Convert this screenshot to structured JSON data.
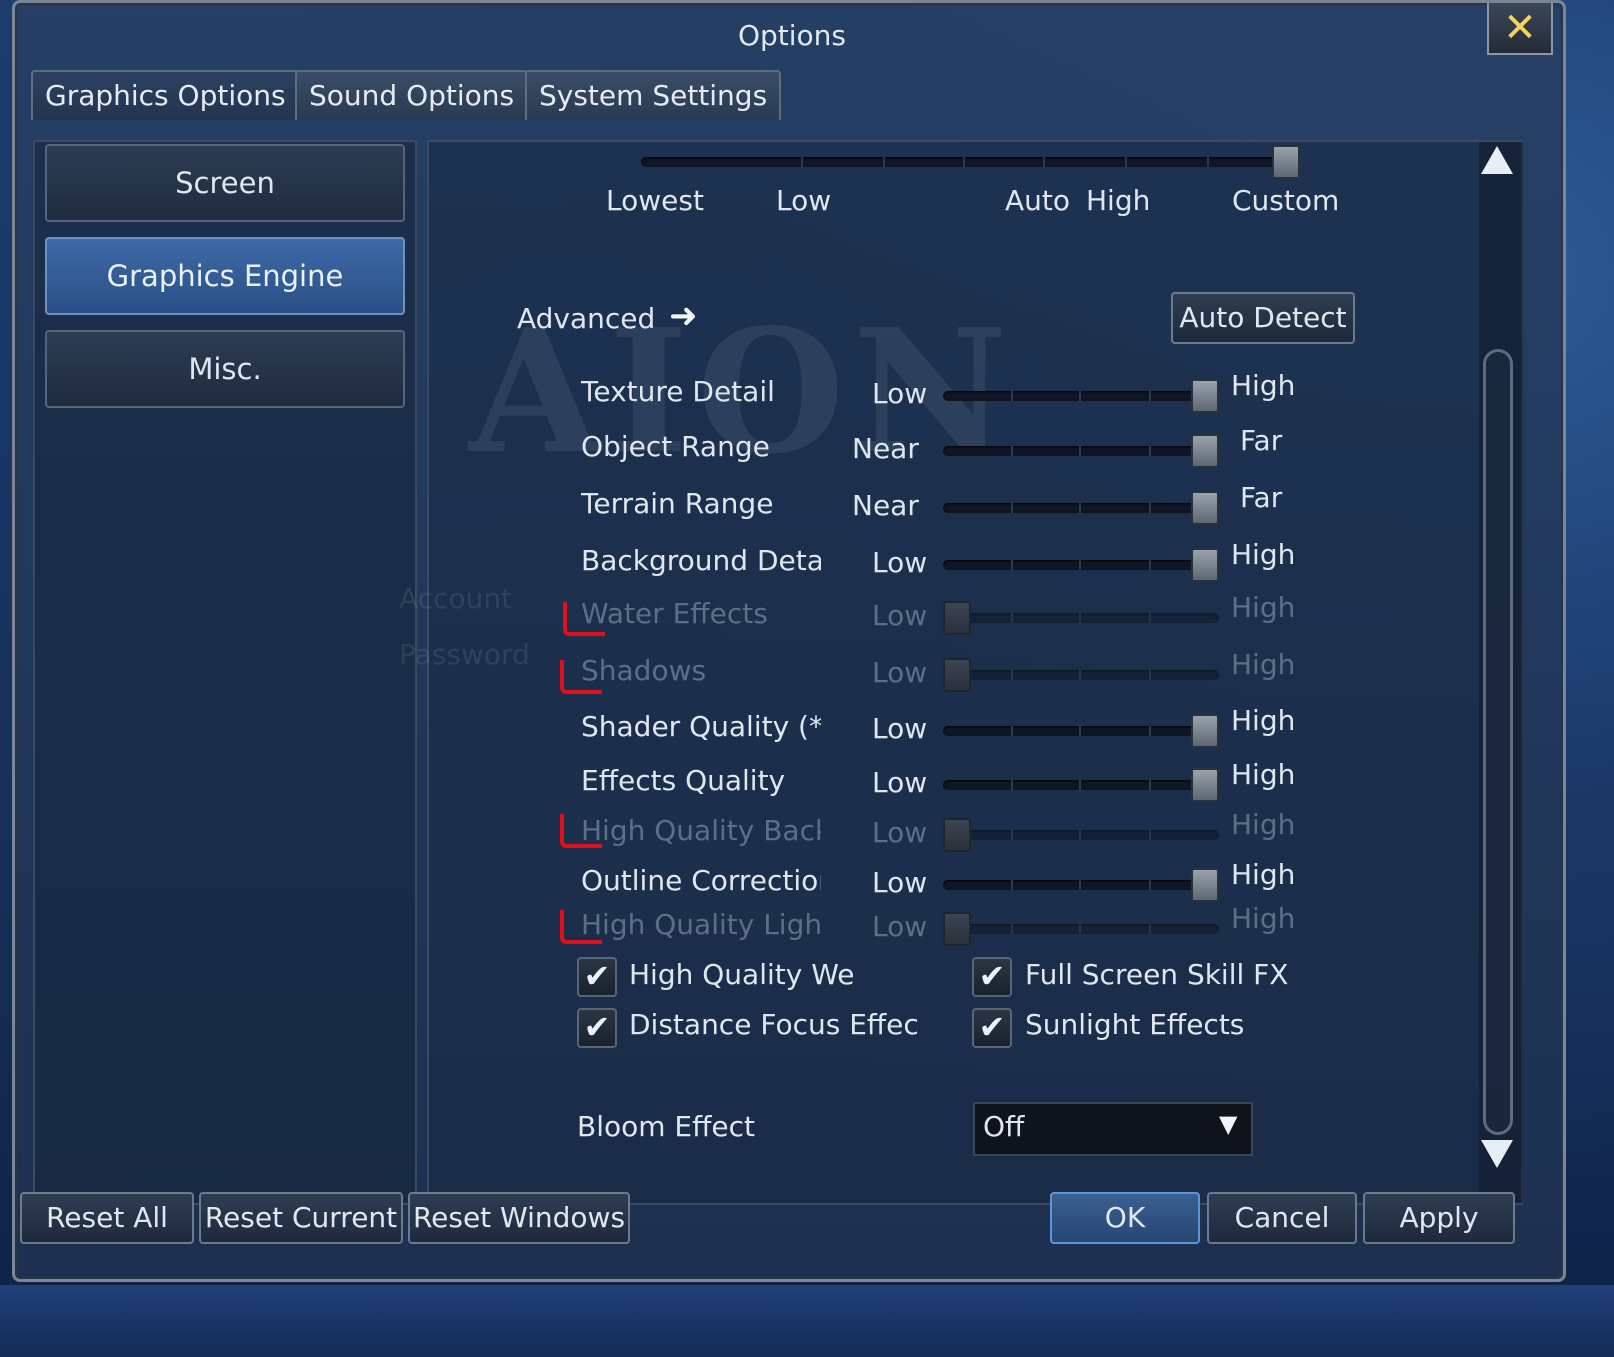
{
  "window": {
    "title": "Options",
    "close_symbol": "✕"
  },
  "tabs": [
    {
      "label": "Graphics Options",
      "active": true
    },
    {
      "label": "Sound Options",
      "active": false
    },
    {
      "label": "System Settings",
      "active": false
    }
  ],
  "sidebar": {
    "items": [
      {
        "label": "Screen",
        "selected": false
      },
      {
        "label": "Graphics Engine",
        "selected": true
      },
      {
        "label": "Misc.",
        "selected": false
      }
    ]
  },
  "preset": {
    "labels": [
      "Lowest",
      "Low",
      "Auto",
      "High",
      "Custom"
    ],
    "selected": "Custom"
  },
  "advanced": {
    "label": "Advanced",
    "arrow": "➜",
    "auto_detect": "Auto Detect"
  },
  "background_text": {
    "watermark": "AION",
    "account": "Account",
    "password": "Password"
  },
  "settings": [
    {
      "label": "Texture Detail",
      "min": "Low",
      "max": "High",
      "value": 1,
      "enabled": true
    },
    {
      "label": "Object Range",
      "min": "Near",
      "max": "Far",
      "value": 1,
      "enabled": true
    },
    {
      "label": "Terrain Range",
      "min": "Near",
      "max": "Far",
      "value": 1,
      "enabled": true
    },
    {
      "label": "Background Deta",
      "min": "Low",
      "max": "High",
      "value": 1,
      "enabled": true
    },
    {
      "label": "Water Effects",
      "min": "Low",
      "max": "High",
      "value": 0,
      "enabled": false
    },
    {
      "label": "Shadows",
      "min": "Low",
      "max": "High",
      "value": 0,
      "enabled": false
    },
    {
      "label": "Shader Quality (*",
      "min": "Low",
      "max": "High",
      "value": 1,
      "enabled": true
    },
    {
      "label": "Effects Quality",
      "min": "Low",
      "max": "High",
      "value": 1,
      "enabled": true
    },
    {
      "label": "High Quality Back",
      "min": "Low",
      "max": "High",
      "value": 0,
      "enabled": false
    },
    {
      "label": "Outline Correctior",
      "min": "Low",
      "max": "High",
      "value": 1,
      "enabled": true
    },
    {
      "label": "High Quality Ligh",
      "min": "Low",
      "max": "High",
      "value": 0,
      "enabled": false
    }
  ],
  "checkboxes": [
    {
      "label": "High Quality We",
      "checked": true
    },
    {
      "label": "Full Screen Skill FX",
      "checked": true
    },
    {
      "label": "Distance Focus Effec",
      "checked": true
    },
    {
      "label": "Sunlight Effects",
      "checked": true
    }
  ],
  "check_symbol": "✔",
  "bloom": {
    "label": "Bloom Effect",
    "value": "Off",
    "arrow": "▼"
  },
  "footer": {
    "reset_all": "Reset All",
    "reset_current": "Reset Current",
    "reset_windows": "Reset Windows",
    "ok": "OK",
    "cancel": "Cancel",
    "apply": "Apply"
  },
  "colors": {
    "annotation_red": "#e0101a",
    "label_text": "#dfe6ee",
    "disabled_text": "#5e6f85"
  }
}
